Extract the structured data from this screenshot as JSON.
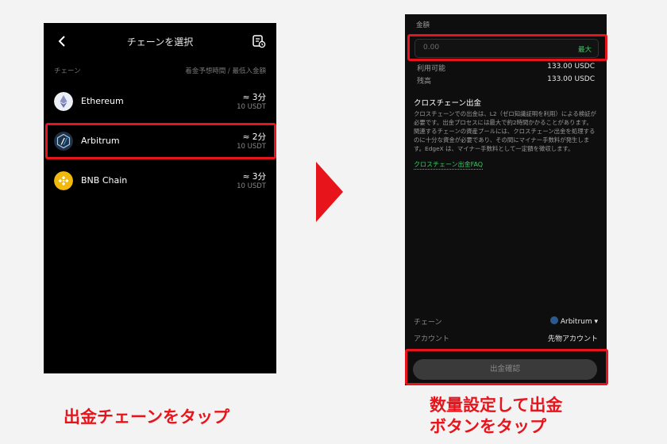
{
  "left_screen": {
    "title": "チェーンを選択",
    "col_left": "チェーン",
    "col_right": "着金予想時間 / 最低入金額",
    "chains": [
      {
        "name": "Ethereum",
        "time": "≈ 3分",
        "fee": "10 USDT"
      },
      {
        "name": "Arbitrum",
        "time": "≈ 2分",
        "fee": "10 USDT"
      },
      {
        "name": "BNB Chain",
        "time": "≈ 3分",
        "fee": "10 USDT"
      }
    ]
  },
  "right_screen": {
    "amount_label": "金額",
    "amount_placeholder": "0.00",
    "max_label": "最大",
    "available_label": "利用可能",
    "available_value": "133.00 USDC",
    "balance_label": "残高",
    "balance_value": "133.00 USDC",
    "cross_title": "クロスチェーン出金",
    "cross_body": "クロスチェーンでの出金は、L2（ゼロ知識証明を利用）による検証が必要です。出金プロセスには最大で約2時間かかることがあります。関連するチェーンの資産プールには、クロスチェーン出金を処理するのに十分な資金が必要であり、その間にマイナー手数料が発生します。EdgeX は、マイナー手数料として一定額を徴収します。",
    "cross_link": "クロスチェーン出金FAQ",
    "chain_label": "チェーン",
    "chain_value": "Arbitrum ▾",
    "account_label": "アカウント",
    "account_value": "先物アカウント",
    "confirm_button": "出金確認"
  },
  "captions": {
    "left": "出金チェーンをタップ",
    "right_line1": "数量設定して出金",
    "right_line2": "ボタンをタップ"
  },
  "colors": {
    "highlight": "#e8141c",
    "accent_green": "#3fc66a"
  }
}
